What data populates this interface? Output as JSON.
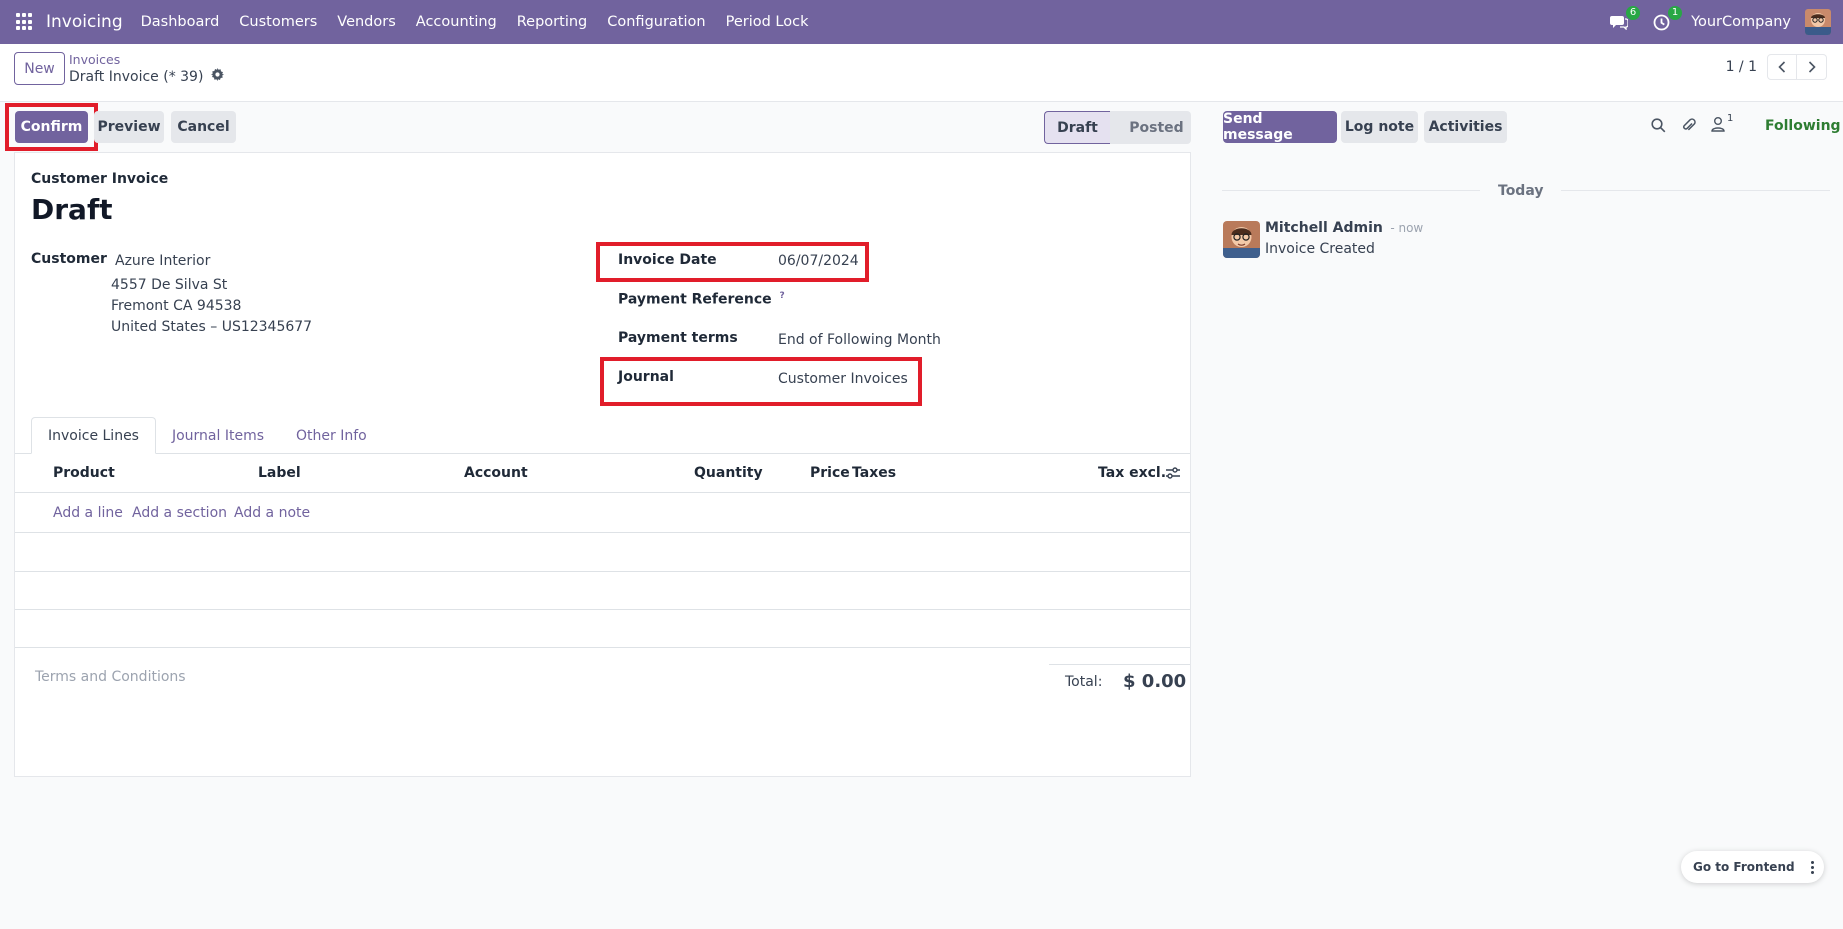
{
  "navbar": {
    "app_name": "Invoicing",
    "menu": [
      "Dashboard",
      "Customers",
      "Vendors",
      "Accounting",
      "Reporting",
      "Configuration",
      "Period Lock"
    ],
    "messages_badge": "6",
    "activities_badge": "1",
    "company": "YourCompany",
    "bg_color": "#71639e"
  },
  "control_panel": {
    "new_label": "New",
    "breadcrumb_parent": "Invoices",
    "breadcrumb_current": "Draft Invoice (* 39)",
    "pager_value": "1 / 1"
  },
  "actions": {
    "confirm": "Confirm",
    "preview": "Preview",
    "cancel": "Cancel"
  },
  "status": {
    "draft": "Draft",
    "posted": "Posted",
    "current": "Draft"
  },
  "form": {
    "move_type": "Customer Invoice",
    "name": "Draft",
    "customer_label": "Customer",
    "customer_name": "Azure Interior",
    "customer_address": [
      "4557 De Silva St",
      "Fremont CA 94538",
      "United States – US12345677"
    ],
    "invoice_date_label": "Invoice Date",
    "invoice_date": "06/07/2024",
    "payment_ref_label": "Payment Reference",
    "payment_ref_help": "?",
    "payment_terms_label": "Payment terms",
    "payment_terms": "End of Following Month",
    "journal_label": "Journal",
    "journal": "Customer Invoices"
  },
  "tabs": [
    "Invoice Lines",
    "Journal Items",
    "Other Info"
  ],
  "lines_table": {
    "columns": [
      "Product",
      "Label",
      "Account",
      "Quantity",
      "Price",
      "Taxes",
      "Tax excl."
    ],
    "add_line": "Add a line",
    "add_section": "Add a section",
    "add_note": "Add a note"
  },
  "footer": {
    "terms_placeholder": "Terms and Conditions",
    "total_label": "Total:",
    "total_value": "$ 0.00"
  },
  "chatter": {
    "send_message": "Send message",
    "log_note": "Log note",
    "activities": "Activities",
    "followers_count": "1",
    "following": "Following",
    "date_separator": "Today",
    "message": {
      "author": "Mitchell Admin",
      "time": "- now",
      "body": "Invoice Created"
    }
  },
  "frontend_button": "Go to Frontend"
}
